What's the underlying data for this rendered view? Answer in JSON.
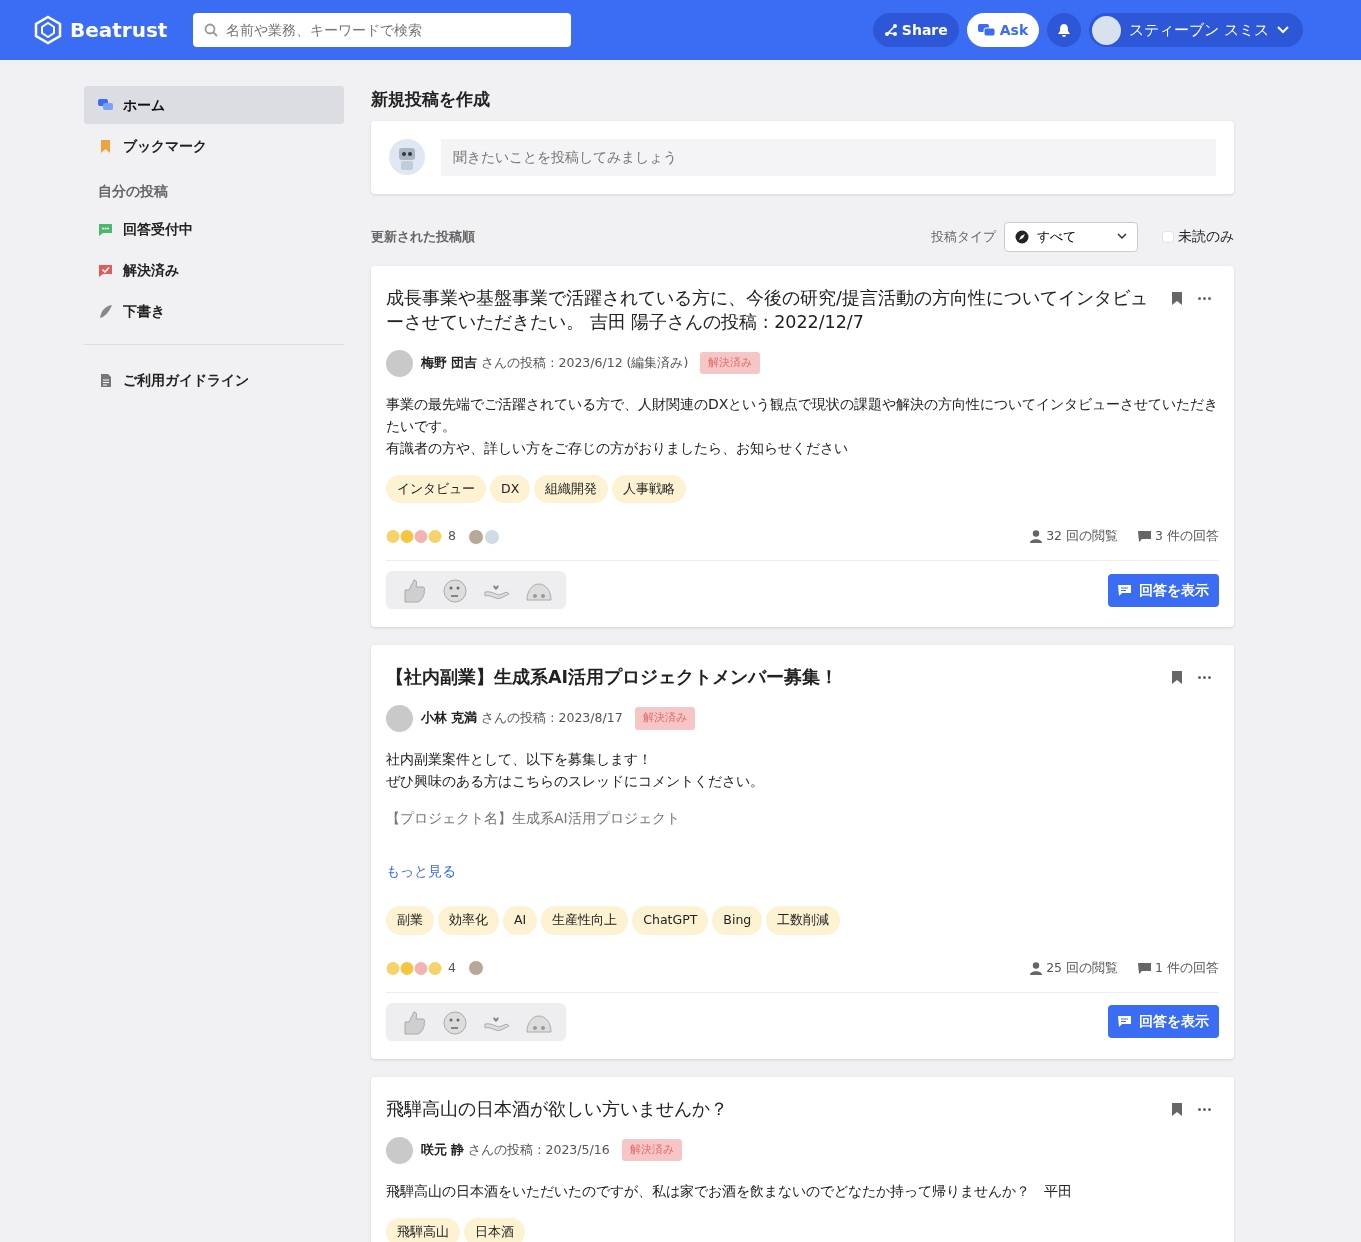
{
  "header": {
    "logo": "Beatrust",
    "search": {
      "placeholder": "名前や業務、キーワードで検索"
    },
    "share_button": "Share",
    "ask_button": "Ask",
    "user_name": "スティーブン スミス"
  },
  "sidebar": {
    "items": [
      {
        "label": "ホーム",
        "selected": true
      },
      {
        "label": "ブックマーク",
        "selected": false
      }
    ],
    "section_title": "自分の投稿",
    "my_posts": [
      {
        "label": "回答受付中",
        "selected": false
      },
      {
        "label": "解決済み",
        "selected": false
      },
      {
        "label": "下書き",
        "selected": false
      }
    ],
    "footer_items": [
      {
        "label": "ご利用ガイドライン",
        "selected": false
      }
    ]
  },
  "composer": {
    "title": "新規投稿を作成",
    "placeholder": "聞きたいことを投稿してみましょう"
  },
  "filter": {
    "sort_label": "更新された投稿順",
    "type_label": "投稿タイプ",
    "type_value": "すべて",
    "unread_only": {
      "label": "未読のみ",
      "checked": false
    }
  },
  "posts": [
    {
      "title": "成長事業や基盤事業で活躍されている方に、今後の研究/提言活動の方向性についてインタビューさせていただきたい。 吉田 陽子さんの投稿 : 2022/12/7",
      "title_bold": false,
      "author": "梅野 団吉",
      "meta": "さんの投稿 : 2023/6/12",
      "edited": "(編集済み)",
      "status": "解決済み",
      "body": [
        {
          "kind": "text",
          "text": "事業の最先端でご活躍されている方で、人財関連のDXという観点で現状の課題や解決の方向性についてインタビューさせていただきたいです。"
        },
        {
          "kind": "text",
          "text": "有識者の方や、詳しい方をご存じの方がおりましたら、お知らせください"
        }
      ],
      "tags": [
        "インタビュー",
        "DX",
        "組織開発",
        "人事戦略"
      ],
      "reaction_count": "8",
      "viewers": [
        {
          "kind": "photo"
        },
        {
          "kind": "robot"
        }
      ],
      "views": "32 回の閲覧",
      "answers": "3 件の回答",
      "show_answers": "回答を表示"
    },
    {
      "title": "【社内副業】生成系AI活用プロジェクトメンバー募集！",
      "title_bold": true,
      "author": "小林 克満",
      "meta": "さんの投稿 : 2023/8/17",
      "status": "解決済み",
      "body": [
        {
          "kind": "text",
          "text": "社内副業案件として、以下を募集します！"
        },
        {
          "kind": "text",
          "text": "ぜひ興味のある方はこちらのスレッドにコメントください。"
        },
        {
          "kind": "muted",
          "text": "【プロジェクト名】生成系AI活用プロジェクト"
        },
        {
          "kind": "more",
          "text": "もっと見る"
        }
      ],
      "tags": [
        "副業",
        "効率化",
        "AI",
        "生産性向上",
        "ChatGPT",
        "Bing",
        "工数削減"
      ],
      "reaction_count": "4",
      "viewers": [
        {
          "kind": "photo"
        }
      ],
      "views": "25 回の閲覧",
      "answers": "1 件の回答",
      "show_answers": "回答を表示"
    },
    {
      "title": "飛騨高山の日本酒が欲しい方いませんか？",
      "title_bold": false,
      "author": "咲元 静",
      "meta": "さんの投稿 : 2023/5/16",
      "status": "解決済み",
      "body": [
        {
          "kind": "text",
          "text": "飛騨高山の日本酒をいただいたのですが、私は家でお酒を飲まないのでどなたか持って帰りませんか？　平田"
        }
      ],
      "tags": [
        "飛騨高山",
        "日本酒"
      ]
    }
  ]
}
